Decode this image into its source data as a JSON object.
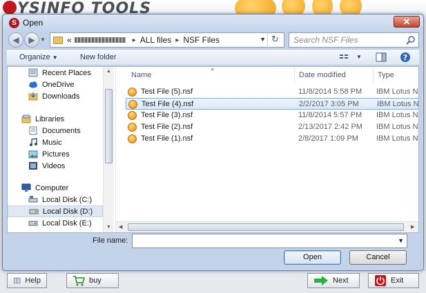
{
  "app": {
    "logo_text": "YSINFO TOOLS",
    "buttons": {
      "help": "Help",
      "buy": "buy",
      "next": "Next",
      "exit": "Exit"
    }
  },
  "dialog": {
    "title": "Open",
    "close_glyph": "✕",
    "breadcrumb": {
      "overflow": "«",
      "items": [
        "ALL files",
        "NSF Files"
      ]
    },
    "search_placeholder": "Search NSF Files",
    "toolbar": {
      "organize": "Organize",
      "new_folder": "New folder"
    },
    "nav": {
      "favorites": [
        "Recent Places",
        "OneDrive",
        "Downloads"
      ],
      "libraries": {
        "label": "Libraries",
        "items": [
          "Documents",
          "Music",
          "Pictures",
          "Videos"
        ]
      },
      "computer": {
        "label": "Computer",
        "items": [
          "Local Disk (C:)",
          "Local Disk (D:)",
          "Local Disk (E:)"
        ]
      }
    },
    "columns": {
      "name": "Name",
      "date": "Date modified",
      "type": "Type"
    },
    "files": [
      {
        "name": "Test File (5).nsf",
        "date": "11/8/2014 5:58 PM",
        "type": "IBM Lotus N"
      },
      {
        "name": "Test File (4).nsf",
        "date": "2/2/2017 3:05 PM",
        "type": "IBM Lotus N"
      },
      {
        "name": "Test File (3).nsf",
        "date": "11/8/2014 5:57 PM",
        "type": "IBM Lotus N"
      },
      {
        "name": "Test File (2).nsf",
        "date": "2/13/2017 2:42 PM",
        "type": "IBM Lotus N"
      },
      {
        "name": "Test File (1).nsf",
        "date": "2/8/2017 1:09 PM",
        "type": "IBM Lotus N"
      }
    ],
    "selected_file_index": 1,
    "file_name_label": "File name:",
    "file_name_value": "",
    "open_label": "Open",
    "cancel_label": "Cancel"
  },
  "colors": {
    "accent": "#3d7bca",
    "selection": "#d8e8fa",
    "brand_red": "#b3161b",
    "nsf_orange": "#e8890c"
  }
}
